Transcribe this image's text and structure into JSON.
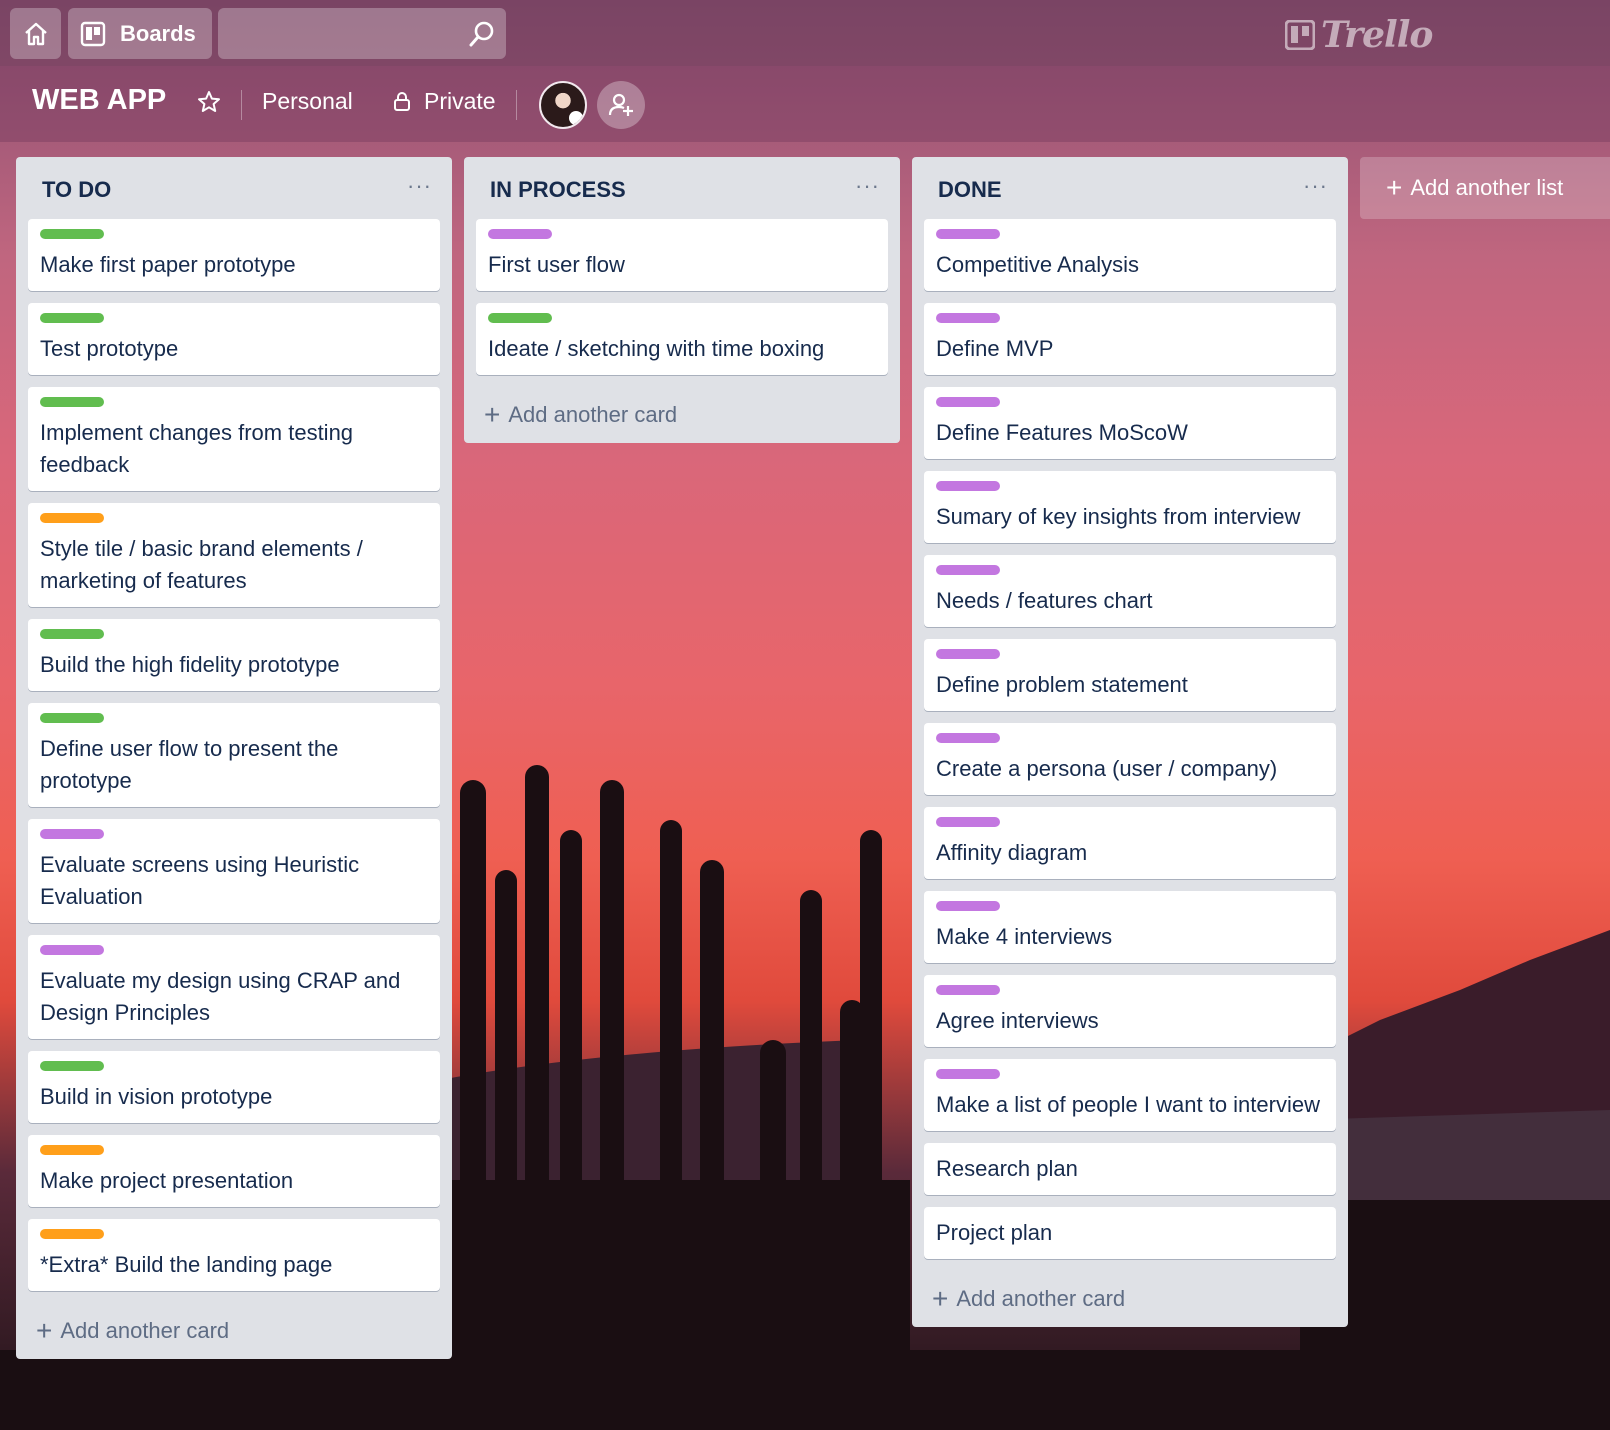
{
  "colors": {
    "green": "#61bd4f",
    "purple": "#c377e0",
    "orange": "#ff9f1a",
    "list_bg": "#dfe1e6",
    "card_text": "#172b4d"
  },
  "nav": {
    "boards_label": "Boards",
    "search_placeholder": "",
    "brand": "Trello"
  },
  "board": {
    "title": "WEB APP",
    "team": "Personal",
    "visibility": "Private"
  },
  "lists": [
    {
      "title": "TO DO",
      "menu": "···",
      "add_card": "Add another card",
      "cards": [
        {
          "text": "Make first paper prototype",
          "label": "green"
        },
        {
          "text": "Test prototype",
          "label": "green"
        },
        {
          "text": "Implement changes from testing feedback",
          "label": "green"
        },
        {
          "text": "Style tile / basic brand elements / marketing of features",
          "label": "orange"
        },
        {
          "text": "Build the high fidelity prototype",
          "label": "green"
        },
        {
          "text": "Define user flow to present the prototype",
          "label": "green"
        },
        {
          "text": "Evaluate screens using Heuristic Evaluation",
          "label": "purple"
        },
        {
          "text": "Evaluate my design using CRAP and Design Principles",
          "label": "purple"
        },
        {
          "text": "Build in vision prototype",
          "label": "green"
        },
        {
          "text": "Make project presentation",
          "label": "orange"
        },
        {
          "text": "*Extra* Build the landing page",
          "label": "orange"
        }
      ]
    },
    {
      "title": "IN PROCESS",
      "menu": "···",
      "add_card": "Add another card",
      "cards": [
        {
          "text": "First user flow",
          "label": "purple"
        },
        {
          "text": "Ideate / sketching with time boxing",
          "label": "green"
        }
      ]
    },
    {
      "title": "DONE",
      "menu": "···",
      "add_card": "Add another card",
      "cards": [
        {
          "text": "Competitive Analysis",
          "label": "purple"
        },
        {
          "text": "Define MVP",
          "label": "purple"
        },
        {
          "text": "Define Features MoScoW",
          "label": "purple"
        },
        {
          "text": "Sumary of key insights from interview",
          "label": "purple"
        },
        {
          "text": "Needs / features chart",
          "label": "purple"
        },
        {
          "text": "Define problem statement",
          "label": "purple"
        },
        {
          "text": "Create a persona (user / company)",
          "label": "purple"
        },
        {
          "text": "Affinity diagram",
          "label": "purple"
        },
        {
          "text": "Make 4 interviews",
          "label": "purple"
        },
        {
          "text": "Agree interviews",
          "label": "purple"
        },
        {
          "text": "Make a list of people I want to interview",
          "label": "purple"
        },
        {
          "text": "Research plan",
          "label": null
        },
        {
          "text": "Project plan",
          "label": null
        }
      ]
    }
  ],
  "add_list": "Add another list",
  "icons": {
    "home": "home-icon",
    "boards": "boards-icon",
    "search": "search-icon",
    "star": "star-icon",
    "lock": "lock-icon",
    "invite": "add-member-icon"
  }
}
